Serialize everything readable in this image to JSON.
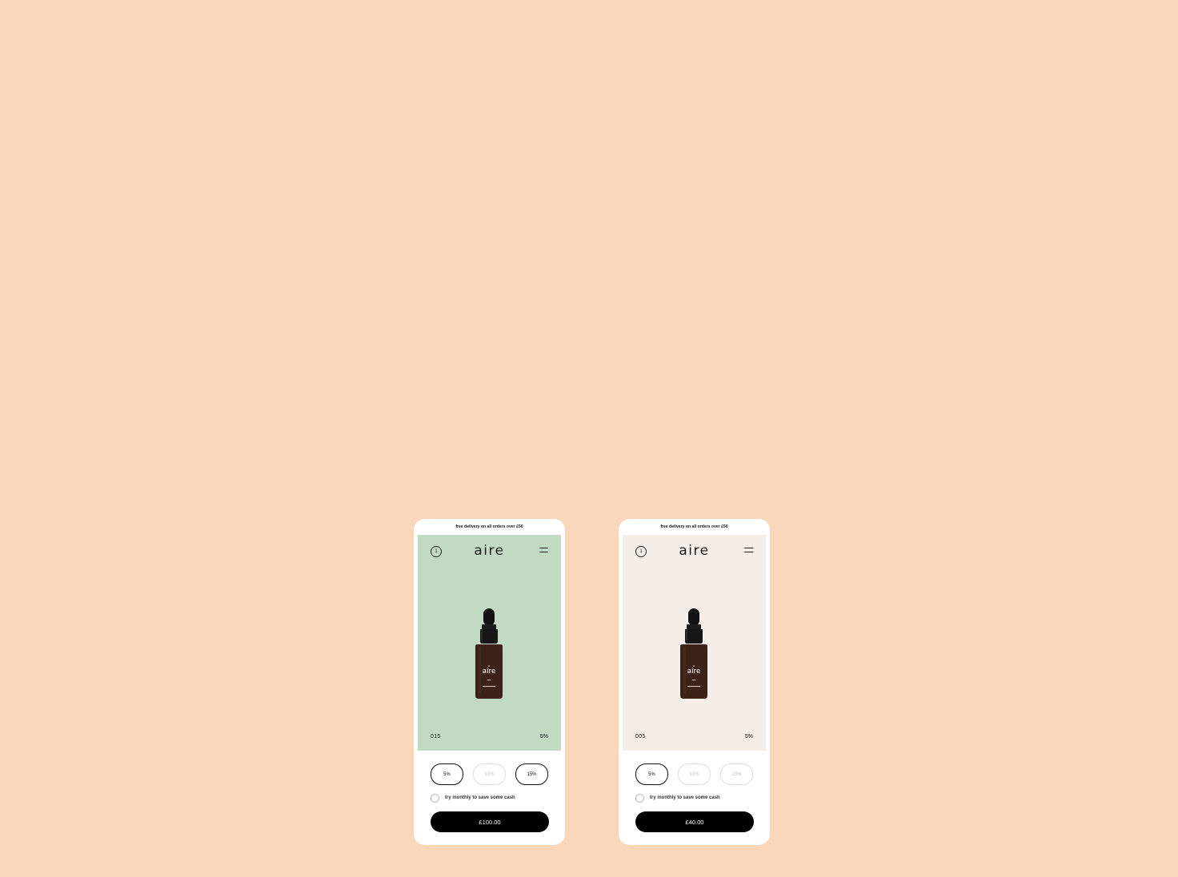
{
  "background_color": "#fad7bb",
  "phones": [
    {
      "banner": "free delivery on all orders over £50",
      "cart_count": "1",
      "logo": "aire",
      "bottle_logo": "aire",
      "hero_color": "#c2dac1",
      "code": "015",
      "strength": "5%",
      "options": [
        {
          "label": "5%",
          "state": "enabled"
        },
        {
          "label": "10%",
          "state": "disabled"
        },
        {
          "label": "15%",
          "state": "enabled"
        }
      ],
      "subscribe_label": "try monthly to save some cash",
      "price_button": "£100.00"
    },
    {
      "banner": "free delivery on all orders over £50",
      "cart_count": "1",
      "logo": "aire",
      "bottle_logo": "aire",
      "hero_color": "#f5eee9",
      "code": "005",
      "strength": "5%",
      "options": [
        {
          "label": "5%",
          "state": "enabled"
        },
        {
          "label": "10%",
          "state": "disabled"
        },
        {
          "label": "15%",
          "state": "disabled"
        }
      ],
      "subscribe_label": "try monthly to save some cash",
      "price_button": "£40.00"
    }
  ],
  "icons": {
    "cart": "cart-count-icon",
    "menu": "hamburger-menu-icon",
    "product": "dropper-bottle-icon"
  }
}
